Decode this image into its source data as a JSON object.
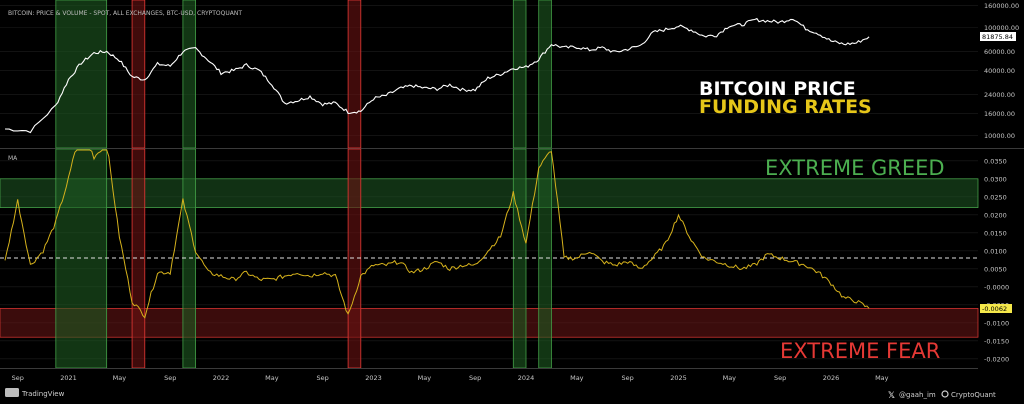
{
  "header": {
    "title": "BITCOIN: PRICE & VOLUME - SPOT, ALL EXCHANGES, BTC-USD, CRYPTOQUANT"
  },
  "legend": {
    "price": "BITCOIN PRICE",
    "funding": "FUNDING RATES",
    "ma": "MA"
  },
  "zones": {
    "greed": "EXTREME GREED",
    "fear": "EXTREME  FEAR"
  },
  "footer": {
    "brand_left": "TradingView",
    "handle": "@gaah_im",
    "brand_right": "CryptoQuant"
  },
  "colors": {
    "background": "#000000",
    "price_line": "#ffffff",
    "funding_line": "#d6b21c",
    "greed_text": "#4caf50",
    "fear_text": "#e53935",
    "greed_zone": "#1f5a24",
    "fear_zone": "#6b1515",
    "last_label_bg": "#f5e84a"
  },
  "icons": {
    "tradingview": "tradingview-logo-icon",
    "x": "x-logo-icon",
    "cryptoquant": "cryptoquant-logo-icon"
  },
  "chart_data": [
    {
      "type": "line",
      "title": "BITCOIN: PRICE & VOLUME - SPOT, ALL EXCHANGES, BTC-USD, CRYPTOQUANT",
      "x_ticks": [
        "Sep",
        "2021",
        "May",
        "Sep",
        "2022",
        "May",
        "Sep",
        "2023",
        "May",
        "Sep",
        "2024",
        "May",
        "Sep",
        "2025",
        "May",
        "Sep",
        "2026",
        "May"
      ],
      "y_ticks": [
        "160000.00",
        "100000.00",
        "60000.00",
        "40000.00",
        "24000.00",
        "16000.00",
        "10000.00"
      ],
      "y_scale": "log",
      "ylim": [
        8000,
        165000
      ],
      "last_value_label": "81875.84",
      "series": [
        {
          "x": [
            "2020-08",
            "2020-10",
            "2020-12",
            "2021-01",
            "2021-02",
            "2021-03",
            "2021-04",
            "2021-05",
            "2021-06",
            "2021-07",
            "2021-08",
            "2021-09",
            "2021-10",
            "2021-11",
            "2021-12",
            "2022-01",
            "2022-02",
            "2022-03",
            "2022-04",
            "2022-05",
            "2022-06",
            "2022-07",
            "2022-08",
            "2022-09",
            "2022-10",
            "2022-11",
            "2022-12",
            "2023-01",
            "2023-02",
            "2023-03",
            "2023-04",
            "2023-05",
            "2023-06",
            "2023-07",
            "2023-08",
            "2023-09",
            "2023-10",
            "2023-11",
            "2023-12",
            "2024-01",
            "2024-02",
            "2024-03",
            "2024-04",
            "2024-05",
            "2024-06",
            "2024-07",
            "2024-08",
            "2024-09",
            "2024-10",
            "2024-11",
            "2024-12",
            "2025-01",
            "2025-02",
            "2025-03",
            "2025-04",
            "2025-05",
            "2025-06",
            "2025-07",
            "2025-08",
            "2025-09",
            "2025-10",
            "2025-11",
            "2025-12",
            "2026-01",
            "2026-02",
            "2026-03",
            "2026-04"
          ],
          "values": [
            11500,
            11000,
            19000,
            33000,
            47000,
            58000,
            60000,
            50000,
            35000,
            33000,
            46000,
            44000,
            60000,
            64000,
            50000,
            38000,
            40000,
            45000,
            40000,
            30000,
            20000,
            21000,
            23000,
            19500,
            20000,
            16500,
            16800,
            22000,
            23500,
            27000,
            29000,
            27500,
            27000,
            29500,
            26500,
            26500,
            34000,
            37000,
            42000,
            43000,
            51000,
            70000,
            65000,
            66000,
            62000,
            65000,
            59000,
            63000,
            68000,
            90000,
            96000,
            103000,
            95000,
            83000,
            85000,
            104000,
            106000,
            118000,
            115000,
            112000,
            122000,
            98000,
            88000,
            75000,
            70000,
            72000,
            82000
          ]
        }
      ]
    },
    {
      "type": "line",
      "title": "MA",
      "x_ticks": [
        "Sep",
        "2021",
        "May",
        "Sep",
        "2022",
        "May",
        "Sep",
        "2023",
        "May",
        "Sep",
        "2024",
        "May",
        "Sep",
        "2025",
        "May",
        "Sep",
        "2026",
        "May"
      ],
      "y_ticks": [
        "0.0350",
        "0.0300",
        "0.0250",
        "0.0200",
        "0.0150",
        "0.0100",
        "0.0050",
        "-0.0000",
        "-0.0050",
        "-0.0100",
        "-0.0150",
        "-0.0200"
      ],
      "ylim": [
        -0.022,
        0.038
      ],
      "last_value_label": "-0.0062",
      "reference_line": 0.008,
      "bands": [
        {
          "name": "EXTREME GREED",
          "from": 0.022,
          "to": 0.03
        },
        {
          "name": "EXTREME  FEAR",
          "from": -0.014,
          "to": -0.006
        }
      ],
      "highlights": [
        {
          "color": "green",
          "from": "2020-12",
          "to": "2021-04"
        },
        {
          "color": "red",
          "from": "2021-06",
          "to": "2021-07"
        },
        {
          "color": "green",
          "from": "2021-10",
          "to": "2021-11"
        },
        {
          "color": "red",
          "from": "2022-11",
          "to": "2022-12"
        },
        {
          "color": "green",
          "from": "2023-12",
          "to": "2024-01"
        },
        {
          "color": "green",
          "from": "2024-02",
          "to": "2024-03"
        }
      ],
      "series": [
        {
          "x": [
            "2020-08",
            "2020-09",
            "2020-10",
            "2020-11",
            "2020-12",
            "2021-01",
            "2021-02",
            "2021-03",
            "2021-04",
            "2021-05",
            "2021-06",
            "2021-07",
            "2021-08",
            "2021-09",
            "2021-10",
            "2021-11",
            "2021-12",
            "2022-01",
            "2022-02",
            "2022-03",
            "2022-04",
            "2022-05",
            "2022-06",
            "2022-07",
            "2022-08",
            "2022-09",
            "2022-10",
            "2022-11",
            "2022-12",
            "2023-01",
            "2023-02",
            "2023-03",
            "2023-04",
            "2023-05",
            "2023-06",
            "2023-07",
            "2023-08",
            "2023-09",
            "2023-10",
            "2023-11",
            "2023-12",
            "2024-01",
            "2024-02",
            "2024-03",
            "2024-04",
            "2024-05",
            "2024-06",
            "2024-07",
            "2024-08",
            "2024-09",
            "2024-10",
            "2024-11",
            "2024-12",
            "2025-01",
            "2025-02",
            "2025-03",
            "2025-04",
            "2025-05",
            "2025-06",
            "2025-07",
            "2025-08",
            "2025-09",
            "2025-10",
            "2025-11",
            "2025-12",
            "2026-01",
            "2026-02",
            "2026-03",
            "2026-04"
          ],
          "values": [
            0.007,
            0.024,
            0.006,
            0.01,
            0.018,
            0.03,
            0.045,
            0.036,
            0.04,
            0.014,
            -0.004,
            -0.008,
            0.004,
            0.004,
            0.024,
            0.01,
            0.004,
            0.003,
            0.002,
            0.004,
            0.002,
            0.002,
            0.003,
            0.004,
            0.003,
            0.004,
            0.003,
            -0.008,
            0.003,
            0.006,
            0.006,
            0.007,
            0.004,
            0.005,
            0.007,
            0.005,
            0.006,
            0.006,
            0.01,
            0.014,
            0.026,
            0.012,
            0.033,
            0.038,
            0.008,
            0.008,
            0.01,
            0.007,
            0.006,
            0.007,
            0.005,
            0.008,
            0.012,
            0.02,
            0.013,
            0.008,
            0.007,
            0.006,
            0.005,
            0.006,
            0.009,
            0.008,
            0.007,
            0.006,
            0.004,
            0.001,
            -0.003,
            -0.004,
            -0.006
          ]
        }
      ]
    }
  ]
}
